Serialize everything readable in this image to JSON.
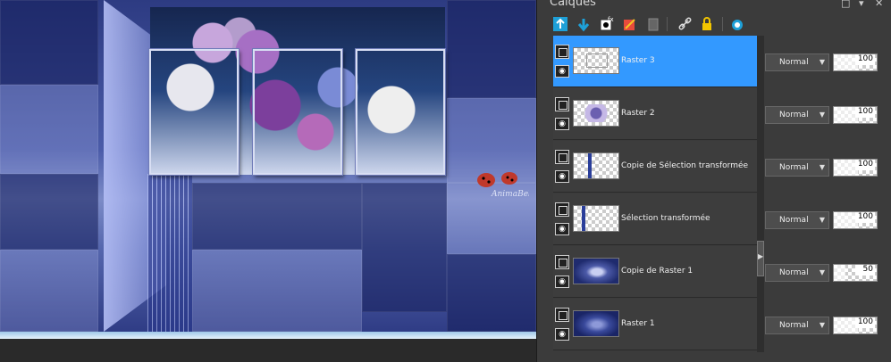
{
  "panel": {
    "title": "Calques",
    "toolbar_icons": [
      "new-raster-layer-icon",
      "new-layer-group-icon",
      "new-mask-layer-icon",
      "new-adjustment-layer-icon",
      "layer-properties-icon",
      "link-layers-icon",
      "lock-layer-icon",
      "show-hide-icon"
    ],
    "selected_color": "#3399ff"
  },
  "layers": [
    {
      "name": "Raster 3",
      "blend": "Normal",
      "opacity": "100",
      "opacity_pct": 100,
      "selected": true
    },
    {
      "name": "Raster 2",
      "blend": "Normal",
      "opacity": "100",
      "opacity_pct": 100,
      "selected": false
    },
    {
      "name": "Copie de Sélection transformée",
      "blend": "Normal",
      "opacity": "100",
      "opacity_pct": 100,
      "selected": false
    },
    {
      "name": "Sélection transformée",
      "blend": "Normal",
      "opacity": "100",
      "opacity_pct": 100,
      "selected": false
    },
    {
      "name": "Copie de Raster 1",
      "blend": "Normal",
      "opacity": "50",
      "opacity_pct": 50,
      "selected": false
    },
    {
      "name": "Raster 1",
      "blend": "Normal",
      "opacity": "100",
      "opacity_pct": 100,
      "selected": false
    }
  ],
  "canvas": {
    "watermark_text": "AnimaBelle"
  }
}
